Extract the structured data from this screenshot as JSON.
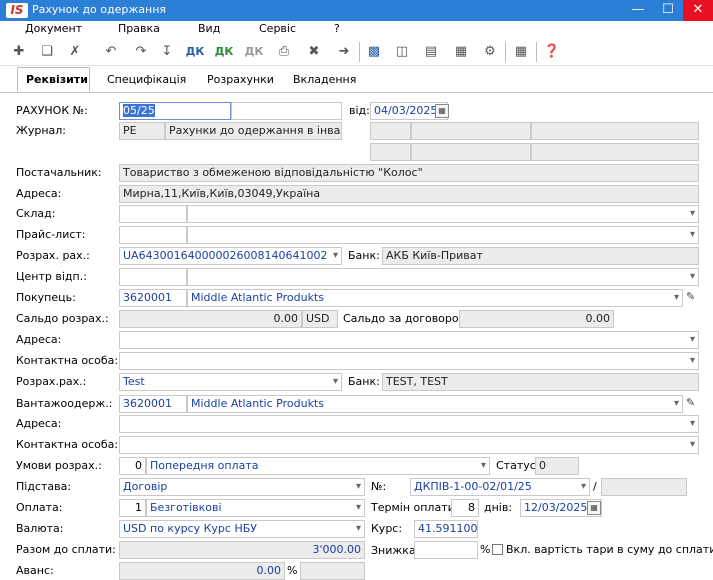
{
  "window": {
    "title": "Рахунок до одержання",
    "logo": "IS"
  },
  "menu": [
    "Документ",
    "Правка",
    "Вид",
    "Сервіс",
    "?"
  ],
  "toolbar_icons": [
    "new-doc-icon",
    "copy-doc-icon",
    "delete-doc-icon",
    "prev-doc-icon",
    "next-doc-icon",
    "dk-icon",
    "dk-green-icon",
    "dk-gray-icon",
    "print-icon",
    "export-icon",
    "exit-icon",
    "save-icon",
    "book-icon",
    "folder-icon",
    "link-icon",
    "tree-icon",
    "grid-icon",
    "help-icon"
  ],
  "toolbar_glyphs": {
    "dk": "ДК"
  },
  "tabs": [
    "Реквізити",
    "Специфікація",
    "Розрахунки",
    "Вкладення"
  ],
  "form": {
    "invoice_no_label": "РАХУНОК №:",
    "invoice_no": "05/25",
    "date_label": "від:",
    "date": "04/03/2025",
    "journal_label": "Журнал:",
    "journal_code": "PE",
    "journal_name": "Рахунки до одержання в інвал...",
    "supplier_label": "Постачальник:",
    "supplier": "Товариство з обмеженою відповідальністю \"Колос\"",
    "address_label": "Адреса:",
    "supplier_address": "Мирна,11,Київ,Київ,03049,Україна",
    "warehouse_label": "Склад:",
    "pricelist_label": "Прайс-лист:",
    "account_label": "Розрах. рах.:",
    "account": "UA643001640000026008140641002",
    "bank_label": "Банк:",
    "bank": "АКБ Київ-Приват",
    "center_label": "Центр відп.:",
    "buyer_label": "Покупець:",
    "buyer_code": "3620001",
    "buyer_name": "Middle Atlantic Produkts",
    "balance_label": "Сальдо розрах.:",
    "balance": "0.00",
    "currency": "USD",
    "contract_balance_label": "Сальдо за договором:",
    "contract_balance": "0.00",
    "address2_label": "Адреса:",
    "contact_label": "Контактна особа:",
    "account2_label": "Розрах.рах.:",
    "account2": "Test",
    "bank2_label": "Банк:",
    "bank2": "TEST, TEST",
    "consignee_label": "Вантажоодерж.:",
    "consignee_code": "3620001",
    "consignee_name": "Middle Atlantic Produkts",
    "address3_label": "Адреса:",
    "contact2_label": "Контактна особа:",
    "terms_label": "Умови розрах.:",
    "terms_code": "0",
    "terms_name": "Попередня оплата",
    "status_label": "Статус:",
    "status": "0",
    "basis_label": "Підстава:",
    "basis": "Договір",
    "no_label": "№:",
    "basis_no": "ДКПІВ-1-00-02/01/25",
    "slash": "/",
    "payment_label": "Оплата:",
    "payment_code": "1",
    "payment_name": "Безготівкові",
    "term_label": "Термін оплати:",
    "term_days": "8",
    "days_label": "днів:",
    "term_date": "12/03/2025",
    "currency_label": "Валюта:",
    "currency_name": "USD по курсу Курс НБУ",
    "rate_label": "Курс:",
    "rate": "41.591100",
    "total_label": "Разом до сплати:",
    "total": "3'000.00",
    "discount_label": "Знижка:",
    "pct": "%",
    "tare_label": "Вкл. вартість тари в суму до сплати",
    "advance_label": "Аванс:",
    "advance": "0.00",
    "advance_pct": "%"
  }
}
